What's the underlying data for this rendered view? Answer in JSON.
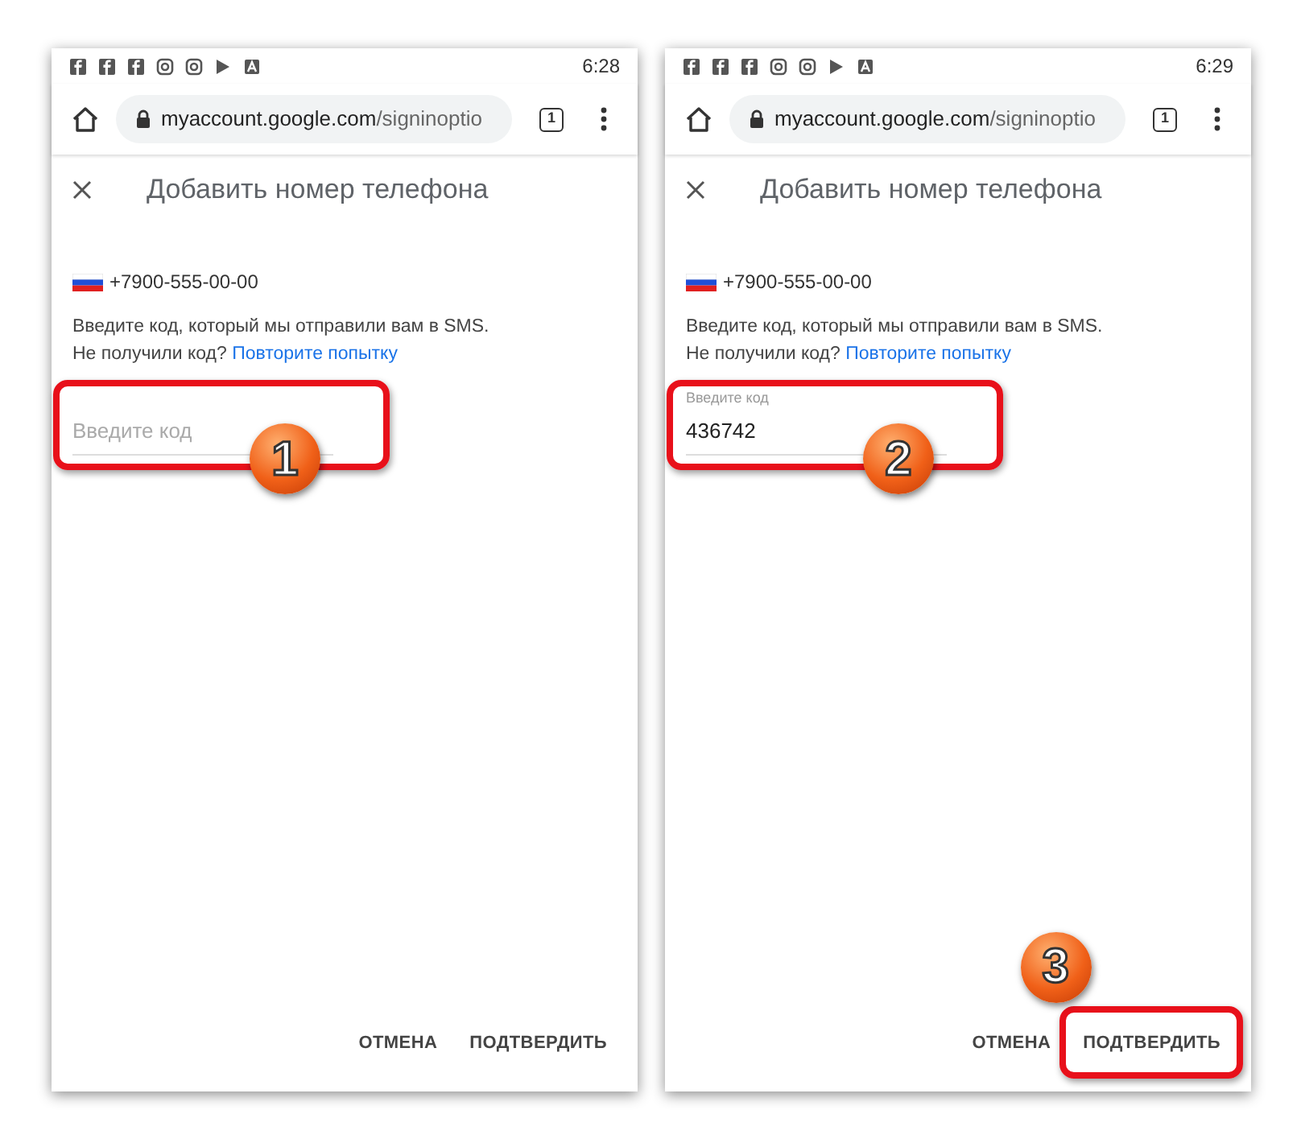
{
  "screens": [
    {
      "status_time": "6:28",
      "url_host": "myaccount.google.com",
      "url_path": "/signinoptio",
      "tab_count": "1",
      "title": "Добавить номер телефона",
      "phone": "+7900-555-00-00",
      "instructions": "Введите код, который мы отправили вам в SMS.",
      "not_received": "Не получили код?",
      "retry_link": "Повторите попытку",
      "field": {
        "placeholder": "Введите код"
      },
      "buttons": [
        {
          "kind": "cancel",
          "label": "ОТМЕНА"
        },
        {
          "kind": "confirm",
          "label": "ПОДТВЕРДИТЬ"
        }
      ],
      "callouts": [
        {
          "number": "1",
          "kind": "field"
        }
      ]
    },
    {
      "status_time": "6:29",
      "url_host": "myaccount.google.com",
      "url_path": "/signinoptio",
      "tab_count": "1",
      "title": "Добавить номер телефона",
      "phone": "+7900-555-00-00",
      "instructions": "Введите код, который мы отправили вам в SMS.",
      "not_received": "Не получили код?",
      "retry_link": "Повторите попытку",
      "field": {
        "label": "Введите код",
        "value": "436742"
      },
      "buttons": [
        {
          "kind": "cancel",
          "label": "ОТМЕНА"
        },
        {
          "kind": "confirm",
          "label": "ПОДТВЕРДИТЬ"
        }
      ],
      "callouts": [
        {
          "number": "2",
          "kind": "field"
        },
        {
          "number": "3",
          "kind": "button"
        }
      ]
    }
  ]
}
